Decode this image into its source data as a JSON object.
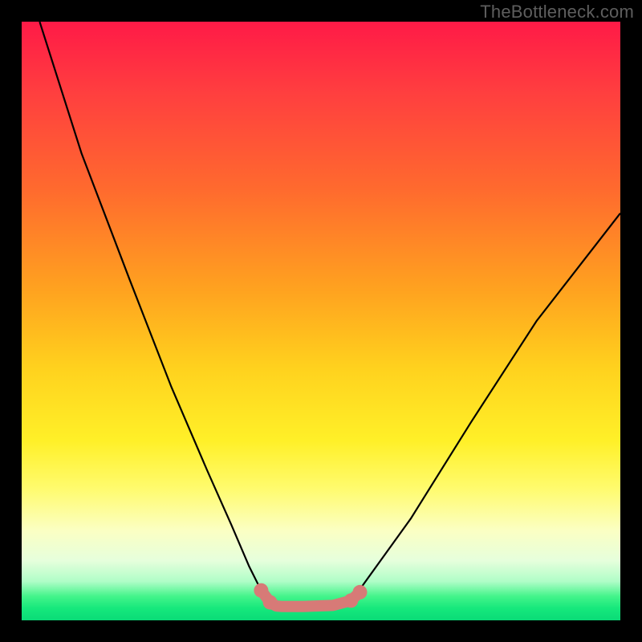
{
  "watermark": "TheBottleneck.com",
  "chart_data": {
    "type": "line",
    "title": "",
    "xlabel": "",
    "ylabel": "",
    "xlim": [
      0,
      100
    ],
    "ylim": [
      0,
      100
    ],
    "series": [
      {
        "name": "black-curve",
        "x": [
          3,
          10,
          18,
          25,
          31,
          35,
          38,
          40,
          41.5,
          42.5,
          43.5,
          47,
          52,
          56,
          65,
          75,
          86,
          100
        ],
        "values": [
          100,
          78,
          57,
          39,
          25,
          16,
          9,
          5,
          3,
          2.4,
          2.3,
          2.3,
          2.5,
          4.5,
          17,
          33,
          50,
          68
        ]
      },
      {
        "name": "pink-floor",
        "x": [
          40,
          41.5,
          42.5,
          43.5,
          47,
          52,
          55,
          56.5
        ],
        "values": [
          5,
          3,
          2.4,
          2.3,
          2.3,
          2.5,
          3.3,
          4.7
        ]
      }
    ],
    "markers": {
      "series": "pink-floor",
      "points": [
        {
          "x": 40,
          "y": 5
        },
        {
          "x": 41.5,
          "y": 3
        },
        {
          "x": 55,
          "y": 3.3
        },
        {
          "x": 56.5,
          "y": 4.7
        }
      ]
    },
    "background_gradient": {
      "orientation": "vertical",
      "stops": [
        {
          "pos": 0,
          "color": "#ff1a47"
        },
        {
          "pos": 0.45,
          "color": "#ffa31f"
        },
        {
          "pos": 0.7,
          "color": "#fff028"
        },
        {
          "pos": 0.9,
          "color": "#e6ffdc"
        },
        {
          "pos": 1.0,
          "color": "#0adb77"
        }
      ]
    }
  }
}
